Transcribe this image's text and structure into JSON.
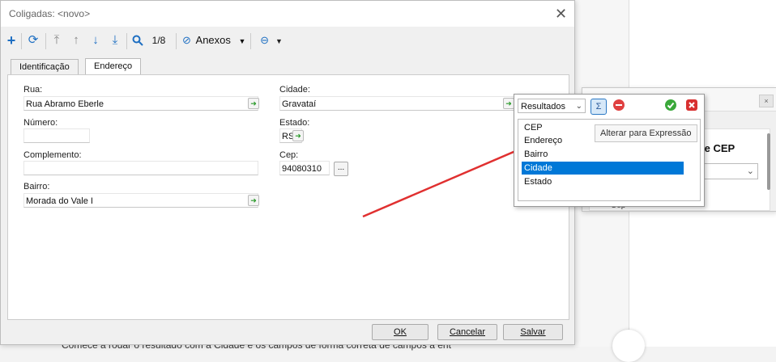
{
  "window": {
    "title": "Coligadas: <novo>",
    "close_glyph": "✕"
  },
  "toolbar": {
    "icons": [
      "add-icon",
      "refresh-icon",
      "first-icon",
      "prev-icon",
      "next-icon",
      "last-icon",
      "search-icon",
      "attach-icon",
      "more-icon"
    ],
    "record_pos": "1/8",
    "anexos_label": "Anexos"
  },
  "tabs": [
    {
      "label": "Identificação",
      "active": false
    },
    {
      "label": "Endereço",
      "active": true
    }
  ],
  "form": {
    "rua": {
      "label": "Rua:",
      "value": "Rua Abramo Eberle"
    },
    "numero": {
      "label": "Número:",
      "value": ""
    },
    "complemento": {
      "label": "Complemento:",
      "value": ""
    },
    "bairro": {
      "label": "Bairro:",
      "value": "Morada do Vale I"
    },
    "cidade": {
      "label": "Cidade:",
      "value": "Gravataí"
    },
    "estado": {
      "label": "Estado:",
      "value": "RS"
    },
    "cep": {
      "label": "Cep:",
      "value": "94080310",
      "btn": "..."
    }
  },
  "buttons": {
    "ok": "OK",
    "cancelar": "Cancelar",
    "salvar": "Salvar"
  },
  "popup": {
    "select_value": "Resultados",
    "sigma": "Σ",
    "list": [
      "CEP",
      "Endereço",
      "Bairro",
      "Cidade",
      "Estado"
    ],
    "selected_index": 3,
    "tooltip": "Alterar para Expressão"
  },
  "background": {
    "heading": "le CEP",
    "cep_label": "Cep",
    "bottom_text": "Comece a rodar o resultado com a Cidade e os campos de forma correta de campos a ent"
  },
  "colors": {
    "accent": "#0078d7",
    "arrow": "#e03030"
  }
}
